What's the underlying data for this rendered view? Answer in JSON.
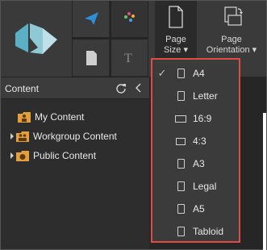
{
  "ribbon": {
    "page_size": {
      "label_line1": "Page",
      "label_line2": "Size ▾"
    },
    "page_orientation": {
      "label_line1": "Page",
      "label_line2": "Orientation ▾"
    }
  },
  "content_panel": {
    "title": "Content",
    "tree": [
      {
        "label": "My Content",
        "expandable": false
      },
      {
        "label": "Workgroup Content",
        "expandable": true
      },
      {
        "label": "Public Content",
        "expandable": true
      }
    ]
  },
  "page_size_menu": {
    "selected": "A4",
    "items": [
      {
        "label": "A4",
        "icon": "page-icon",
        "checked": true
      },
      {
        "label": "Letter",
        "icon": "page-icon",
        "checked": false
      },
      {
        "label": "16:9",
        "icon": "widescreen-icon",
        "checked": false
      },
      {
        "label": "4:3",
        "icon": "standard-screen-icon",
        "checked": false
      },
      {
        "label": "A3",
        "icon": "page-icon",
        "checked": false
      },
      {
        "label": "Legal",
        "icon": "page-icon",
        "checked": false
      },
      {
        "label": "A5",
        "icon": "page-icon",
        "checked": false
      },
      {
        "label": "Tabloid",
        "icon": "page-icon",
        "checked": false
      }
    ]
  },
  "colors": {
    "highlight_border": "#e14a45",
    "logo_teal": "#5ab0c4",
    "send_icon_blue": "#2e8fd8",
    "folder_orange": "#e3a03a"
  }
}
